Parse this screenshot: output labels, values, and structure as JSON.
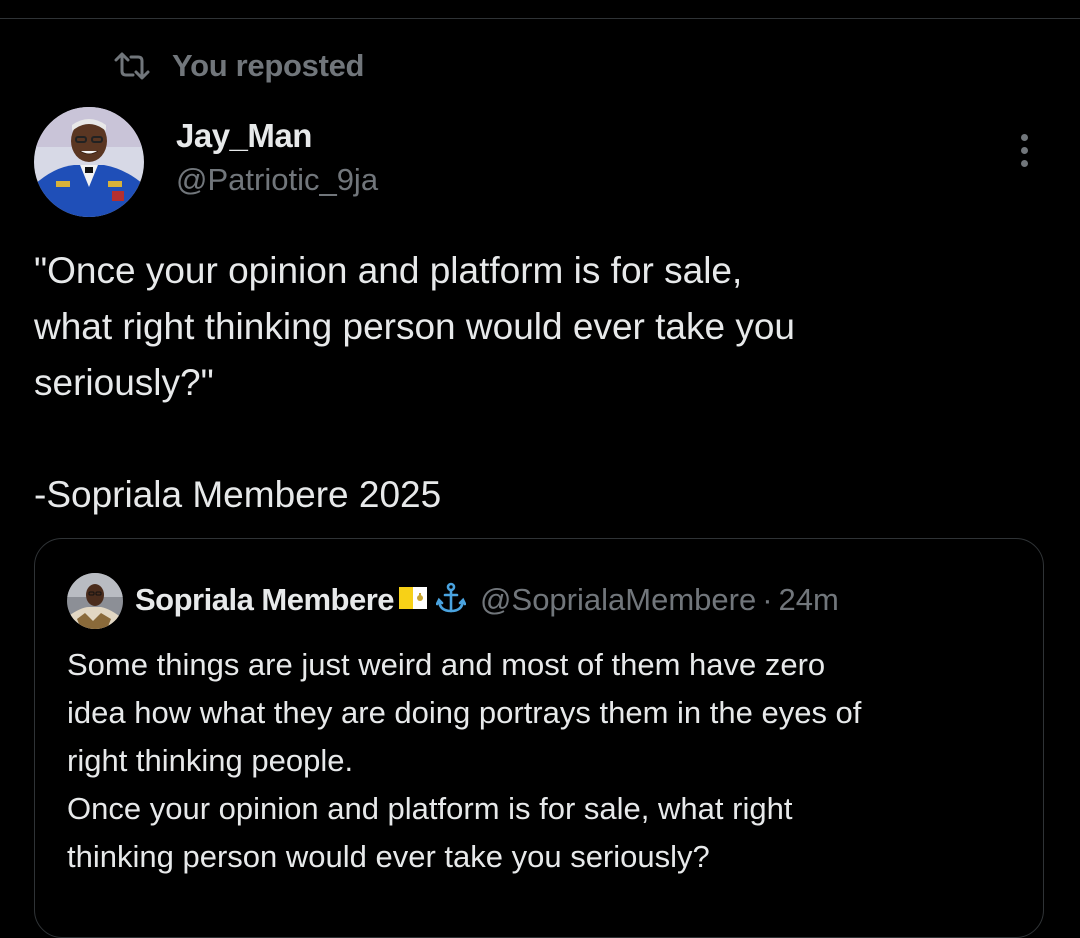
{
  "repost": {
    "label": "You reposted",
    "icon": "repost-icon"
  },
  "author": {
    "name": "Jay_Man",
    "handle": "@Patriotic_9ja",
    "avatar": "avatar"
  },
  "tweet": {
    "text": "\"Once your opinion and platform is for sale,\nwhat right thinking person would ever take you\nseriously?\"\n\n-Sopriala Membere 2025"
  },
  "more_icon": "more-options-icon",
  "quote": {
    "name": "Sopriala Membere",
    "emoji_icons": [
      "vatican-flag-icon",
      "anchor-icon"
    ],
    "handle": "@SoprialaMembere",
    "separator": "·",
    "time": "24m",
    "text": "Some things are just weird and most of them have zero\nidea how what they are doing portrays them in the eyes of\nright thinking people.\nOnce your opinion and platform is for sale, what right\nthinking person would ever take you seriously?"
  },
  "colors": {
    "background": "#000000",
    "primary_text": "#e7e9ea",
    "secondary_text": "#71767b",
    "border": "#2f3336"
  }
}
